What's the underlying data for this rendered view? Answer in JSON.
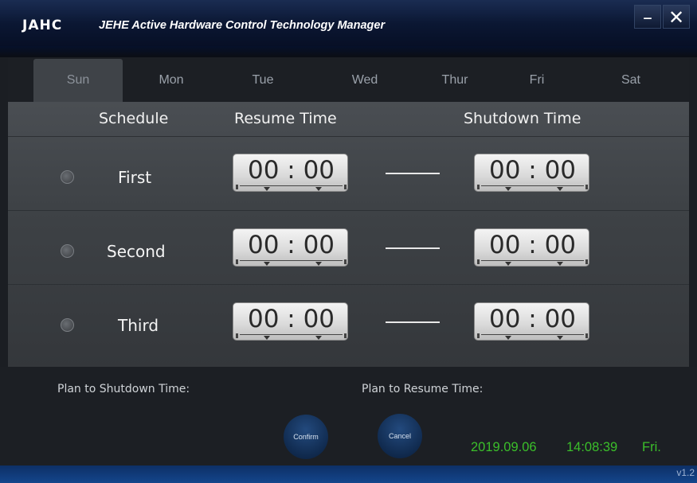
{
  "app": {
    "logo": "JAHC",
    "title": "JEHE Active Hardware Control Technology Manager",
    "minimize": "–",
    "close": "✕"
  },
  "tabs": [
    {
      "label": "Sun",
      "active": true
    },
    {
      "label": "Mon",
      "active": false
    },
    {
      "label": "Tue",
      "active": false
    },
    {
      "label": "Wed",
      "active": false
    },
    {
      "label": "Thur",
      "active": false
    },
    {
      "label": "Fri",
      "active": false
    },
    {
      "label": "Sat",
      "active": false
    }
  ],
  "headers": {
    "schedule": "Schedule",
    "resume": "Resume Time",
    "shutdown": "Shutdown Time"
  },
  "rows": [
    {
      "label": "First",
      "resume": "00 : 00",
      "shutdown": "00 : 00"
    },
    {
      "label": "Second",
      "resume": "00 : 00",
      "shutdown": "00 : 00"
    },
    {
      "label": "Third",
      "resume": "00 : 00",
      "shutdown": "00 : 00"
    }
  ],
  "footer": {
    "plan_shutdown": "Plan to Shutdown Time:",
    "plan_resume": "Plan to Resume Time:",
    "confirm": "Confirm",
    "cancel": "Cancel",
    "date": "2019.09.06",
    "time": "14:08:39",
    "weekday": "Fri.",
    "version": "v1.2"
  },
  "colors": {
    "accent_green": "#3bbf2a",
    "title_blue": "#0b1733",
    "button_blue": "#163a6a"
  }
}
